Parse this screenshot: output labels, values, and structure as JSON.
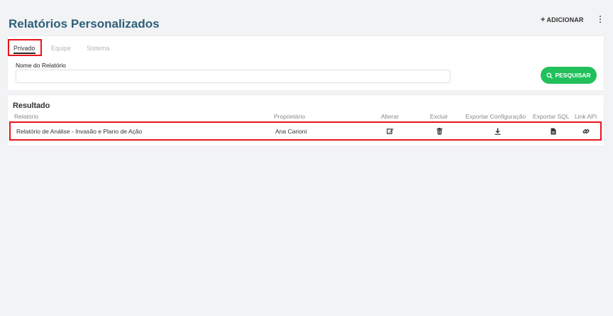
{
  "header": {
    "title": "Relatórios Personalizados",
    "add_label": "ADICIONAR"
  },
  "tabs": [
    {
      "label": "Privado",
      "active": true
    },
    {
      "label": "Equipe",
      "active": false
    },
    {
      "label": "Sistema",
      "active": false
    }
  ],
  "filter": {
    "field_label": "Nome do Relatório",
    "value": "",
    "placeholder": "",
    "search_label": "PESQUISAR"
  },
  "result": {
    "title": "Resultado",
    "columns": [
      "Relatório",
      "Proprietário",
      "Alterar",
      "Excluir",
      "Exportar Configuração",
      "Exportar SQL",
      "Link API"
    ],
    "rows": [
      {
        "report": "Relatório de Análise - Invasão e Plano de Ação",
        "owner": "Ana Carioni"
      }
    ]
  },
  "icons": {
    "edit": "edit-icon",
    "delete": "trash-icon",
    "export_config": "download-icon",
    "export_sql": "file-icon",
    "link_api": "link-icon"
  },
  "colors": {
    "title": "#2e5f7a",
    "accent_green": "#21c05b",
    "highlight_red": "#e8141b"
  }
}
